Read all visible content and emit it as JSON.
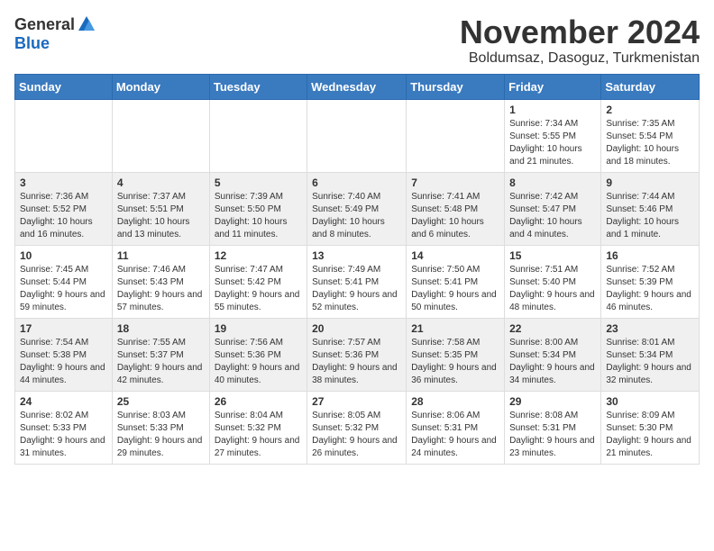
{
  "header": {
    "logo_general": "General",
    "logo_blue": "Blue",
    "month": "November 2024",
    "location": "Boldumsaz, Dasoguz, Turkmenistan"
  },
  "weekdays": [
    "Sunday",
    "Monday",
    "Tuesday",
    "Wednesday",
    "Thursday",
    "Friday",
    "Saturday"
  ],
  "weeks": [
    [
      {
        "day": "",
        "info": ""
      },
      {
        "day": "",
        "info": ""
      },
      {
        "day": "",
        "info": ""
      },
      {
        "day": "",
        "info": ""
      },
      {
        "day": "",
        "info": ""
      },
      {
        "day": "1",
        "info": "Sunrise: 7:34 AM\nSunset: 5:55 PM\nDaylight: 10 hours and 21 minutes."
      },
      {
        "day": "2",
        "info": "Sunrise: 7:35 AM\nSunset: 5:54 PM\nDaylight: 10 hours and 18 minutes."
      }
    ],
    [
      {
        "day": "3",
        "info": "Sunrise: 7:36 AM\nSunset: 5:52 PM\nDaylight: 10 hours and 16 minutes."
      },
      {
        "day": "4",
        "info": "Sunrise: 7:37 AM\nSunset: 5:51 PM\nDaylight: 10 hours and 13 minutes."
      },
      {
        "day": "5",
        "info": "Sunrise: 7:39 AM\nSunset: 5:50 PM\nDaylight: 10 hours and 11 minutes."
      },
      {
        "day": "6",
        "info": "Sunrise: 7:40 AM\nSunset: 5:49 PM\nDaylight: 10 hours and 8 minutes."
      },
      {
        "day": "7",
        "info": "Sunrise: 7:41 AM\nSunset: 5:48 PM\nDaylight: 10 hours and 6 minutes."
      },
      {
        "day": "8",
        "info": "Sunrise: 7:42 AM\nSunset: 5:47 PM\nDaylight: 10 hours and 4 minutes."
      },
      {
        "day": "9",
        "info": "Sunrise: 7:44 AM\nSunset: 5:46 PM\nDaylight: 10 hours and 1 minute."
      }
    ],
    [
      {
        "day": "10",
        "info": "Sunrise: 7:45 AM\nSunset: 5:44 PM\nDaylight: 9 hours and 59 minutes."
      },
      {
        "day": "11",
        "info": "Sunrise: 7:46 AM\nSunset: 5:43 PM\nDaylight: 9 hours and 57 minutes."
      },
      {
        "day": "12",
        "info": "Sunrise: 7:47 AM\nSunset: 5:42 PM\nDaylight: 9 hours and 55 minutes."
      },
      {
        "day": "13",
        "info": "Sunrise: 7:49 AM\nSunset: 5:41 PM\nDaylight: 9 hours and 52 minutes."
      },
      {
        "day": "14",
        "info": "Sunrise: 7:50 AM\nSunset: 5:41 PM\nDaylight: 9 hours and 50 minutes."
      },
      {
        "day": "15",
        "info": "Sunrise: 7:51 AM\nSunset: 5:40 PM\nDaylight: 9 hours and 48 minutes."
      },
      {
        "day": "16",
        "info": "Sunrise: 7:52 AM\nSunset: 5:39 PM\nDaylight: 9 hours and 46 minutes."
      }
    ],
    [
      {
        "day": "17",
        "info": "Sunrise: 7:54 AM\nSunset: 5:38 PM\nDaylight: 9 hours and 44 minutes."
      },
      {
        "day": "18",
        "info": "Sunrise: 7:55 AM\nSunset: 5:37 PM\nDaylight: 9 hours and 42 minutes."
      },
      {
        "day": "19",
        "info": "Sunrise: 7:56 AM\nSunset: 5:36 PM\nDaylight: 9 hours and 40 minutes."
      },
      {
        "day": "20",
        "info": "Sunrise: 7:57 AM\nSunset: 5:36 PM\nDaylight: 9 hours and 38 minutes."
      },
      {
        "day": "21",
        "info": "Sunrise: 7:58 AM\nSunset: 5:35 PM\nDaylight: 9 hours and 36 minutes."
      },
      {
        "day": "22",
        "info": "Sunrise: 8:00 AM\nSunset: 5:34 PM\nDaylight: 9 hours and 34 minutes."
      },
      {
        "day": "23",
        "info": "Sunrise: 8:01 AM\nSunset: 5:34 PM\nDaylight: 9 hours and 32 minutes."
      }
    ],
    [
      {
        "day": "24",
        "info": "Sunrise: 8:02 AM\nSunset: 5:33 PM\nDaylight: 9 hours and 31 minutes."
      },
      {
        "day": "25",
        "info": "Sunrise: 8:03 AM\nSunset: 5:33 PM\nDaylight: 9 hours and 29 minutes."
      },
      {
        "day": "26",
        "info": "Sunrise: 8:04 AM\nSunset: 5:32 PM\nDaylight: 9 hours and 27 minutes."
      },
      {
        "day": "27",
        "info": "Sunrise: 8:05 AM\nSunset: 5:32 PM\nDaylight: 9 hours and 26 minutes."
      },
      {
        "day": "28",
        "info": "Sunrise: 8:06 AM\nSunset: 5:31 PM\nDaylight: 9 hours and 24 minutes."
      },
      {
        "day": "29",
        "info": "Sunrise: 8:08 AM\nSunset: 5:31 PM\nDaylight: 9 hours and 23 minutes."
      },
      {
        "day": "30",
        "info": "Sunrise: 8:09 AM\nSunset: 5:30 PM\nDaylight: 9 hours and 21 minutes."
      }
    ]
  ]
}
